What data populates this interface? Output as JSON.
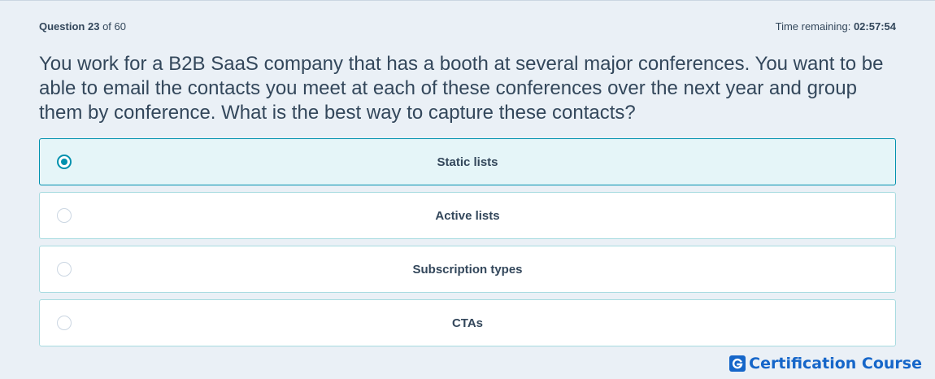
{
  "header": {
    "question_label": "Question",
    "question_number": "23",
    "question_of": "of 60",
    "time_label": "Time remaining:",
    "time_value": "02:57:54"
  },
  "question": {
    "text": "You work for a B2B SaaS company that has a booth at several major conferences. You want to be able to email the contacts you meet at each of these conferences over the next year and group them by conference. What is the best way to capture these contacts?"
  },
  "options": [
    {
      "label": "Static lists",
      "selected": true
    },
    {
      "label": "Active lists",
      "selected": false
    },
    {
      "label": "Subscription types",
      "selected": false
    },
    {
      "label": "CTAs",
      "selected": false
    }
  ],
  "brand": {
    "name": "Certification Course",
    "icon": "g-logo-icon"
  },
  "colors": {
    "background": "#eaf0f6",
    "accent": "#0091ae",
    "option_border": "#a8dbe0",
    "selected_bg": "#e5f5f8",
    "brand": "#1566c9",
    "text": "#33475b"
  }
}
